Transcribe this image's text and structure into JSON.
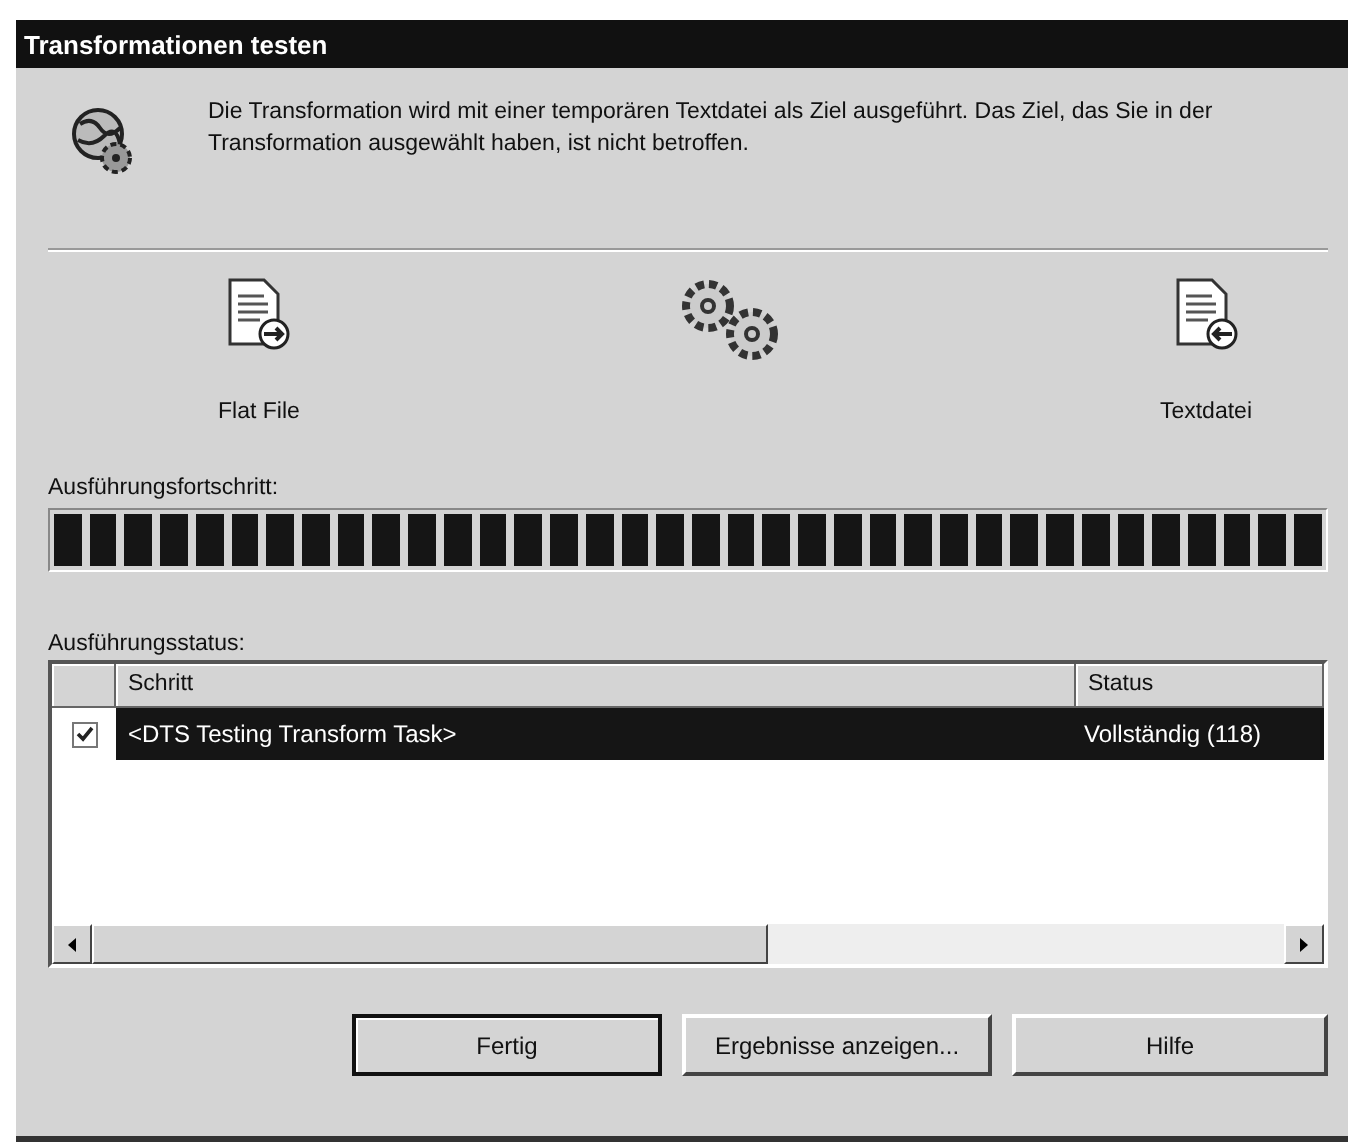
{
  "window": {
    "title": "Transformationen testen"
  },
  "description": "Die Transformation wird mit einer temporären Textdatei als Ziel ausgeführt. Das Ziel, das Sie in der Transformation ausgewählt haben, ist nicht betroffen.",
  "source": {
    "label": "Flat File"
  },
  "destination": {
    "label": "Textdatei"
  },
  "progress": {
    "label": "Ausführungsfortschritt:",
    "level": 1
  },
  "status": {
    "label": "Ausführungsstatus:",
    "columns": [
      "Schritt",
      "Status"
    ],
    "rows": [
      {
        "step": "<DTS Testing Transform Task>",
        "status": "Vollständig (118)",
        "checked": true,
        "selected": true
      }
    ]
  },
  "buttons": [
    {
      "label": "Fertig",
      "default": true
    },
    {
      "label": "Ergebnisse anzeigen...",
      "default": false
    },
    {
      "label": "Hilfe",
      "default": false
    }
  ]
}
